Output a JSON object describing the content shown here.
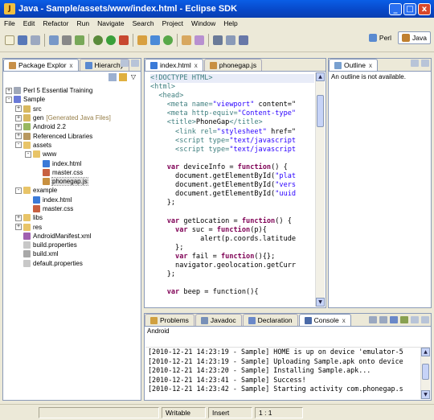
{
  "window": {
    "title": "Java - Sample/assets/www/index.html - Eclipse SDK",
    "min": "_",
    "max": "□",
    "close": "x"
  },
  "menu": [
    "File",
    "Edit",
    "Refactor",
    "Run",
    "Navigate",
    "Search",
    "Project",
    "Window",
    "Help"
  ],
  "perspectives": [
    {
      "label": "Perl",
      "color": "#5a8ad0"
    },
    {
      "label": "Java",
      "color": "#c08030"
    }
  ],
  "package_explorer": {
    "tabs": [
      {
        "label": "Package Explor",
        "close": "x"
      },
      {
        "label": "Hierarchy"
      }
    ],
    "tree": [
      {
        "label": "Perl 5 Essential Training",
        "depth": 0,
        "tw": "+",
        "icon": "#a0a8b8"
      },
      {
        "label": "Sample",
        "depth": 0,
        "tw": "-",
        "icon": "#6a7ad8"
      },
      {
        "label": "src",
        "depth": 1,
        "tw": "+",
        "icon": "#d8b860"
      },
      {
        "label": "gen",
        "extra": "[Generated Java Files]",
        "depth": 1,
        "tw": "+",
        "icon": "#d8b860"
      },
      {
        "label": "Android 2.2",
        "depth": 1,
        "tw": "+",
        "icon": "#98b860"
      },
      {
        "label": "Referenced Libraries",
        "depth": 1,
        "tw": "+",
        "icon": "#b89860"
      },
      {
        "label": "assets",
        "depth": 1,
        "tw": "-",
        "icon": "#e8c468"
      },
      {
        "label": "www",
        "depth": 2,
        "tw": "-",
        "icon": "#e8c468"
      },
      {
        "label": "index.html",
        "depth": 3,
        "tw": "",
        "icon": "#3a7ad8"
      },
      {
        "label": "master.css",
        "depth": 3,
        "tw": "",
        "icon": "#c86040"
      },
      {
        "label": "phonegap.js",
        "depth": 3,
        "tw": "",
        "icon": "#c89040",
        "selected": true
      },
      {
        "label": "example",
        "depth": 1,
        "tw": "-",
        "icon": "#e8c468"
      },
      {
        "label": "index.html",
        "depth": 2,
        "tw": "",
        "icon": "#3a7ad8"
      },
      {
        "label": "master.css",
        "depth": 2,
        "tw": "",
        "icon": "#c86040"
      },
      {
        "label": "libs",
        "depth": 1,
        "tw": "+",
        "icon": "#e8c468"
      },
      {
        "label": "res",
        "depth": 1,
        "tw": "+",
        "icon": "#e8c468"
      },
      {
        "label": "AndroidManifest.xml",
        "depth": 1,
        "tw": "",
        "icon": "#a060b0"
      },
      {
        "label": "build.properties",
        "depth": 1,
        "tw": "",
        "icon": "#c8c8c8"
      },
      {
        "label": "build.xml",
        "depth": 1,
        "tw": "",
        "icon": "#a8a8a8"
      },
      {
        "label": "default.properties",
        "depth": 1,
        "tw": "",
        "icon": "#c8c8c8"
      }
    ]
  },
  "editor": {
    "tabs": [
      {
        "label": "index.html",
        "close": "x"
      },
      {
        "label": "phonegap.js"
      }
    ],
    "lines": [
      [
        [
          "<!DOCTYPE HTML>",
          "tag"
        ]
      ],
      [
        [
          "<html>",
          "tag"
        ]
      ],
      [
        [
          "  <head>",
          "tag"
        ]
      ],
      [
        [
          "    <meta ",
          "tag"
        ],
        [
          "name=",
          "tag"
        ],
        [
          "\"viewport\"",
          "str"
        ],
        [
          " content=\"",
          ""
        ]
      ],
      [
        [
          "    <meta ",
          "tag"
        ],
        [
          "http-equiv=",
          "tag"
        ],
        [
          "\"Content-type\"",
          "str"
        ]
      ],
      [
        [
          "    <title>",
          "tag"
        ],
        [
          "PhoneGap",
          ""
        ],
        [
          "</title>",
          "tag"
        ]
      ],
      [
        [
          "      <link ",
          "tag"
        ],
        [
          "rel=",
          "tag"
        ],
        [
          "\"stylesheet\"",
          "str"
        ],
        [
          " href=\"",
          ""
        ]
      ],
      [
        [
          "      <script ",
          "tag"
        ],
        [
          "type=",
          "tag"
        ],
        [
          "\"text/javascript",
          "str"
        ]
      ],
      [
        [
          "      <script ",
          "tag"
        ],
        [
          "type=",
          "tag"
        ],
        [
          "\"text/javascript",
          "str"
        ]
      ],
      [
        [
          "",
          ""
        ]
      ],
      [
        [
          "    ",
          ""
        ],
        [
          "var",
          "kw"
        ],
        [
          " deviceInfo = ",
          ""
        ],
        [
          "function",
          "kw"
        ],
        [
          "() {",
          ""
        ]
      ],
      [
        [
          "      document.getElementById(",
          ""
        ],
        [
          "\"plat",
          "str"
        ]
      ],
      [
        [
          "      document.getElementById(",
          ""
        ],
        [
          "\"vers",
          "str"
        ]
      ],
      [
        [
          "      document.getElementById(",
          ""
        ],
        [
          "\"uuid",
          "str"
        ]
      ],
      [
        [
          "    };",
          ""
        ]
      ],
      [
        [
          "",
          ""
        ]
      ],
      [
        [
          "    ",
          ""
        ],
        [
          "var",
          "kw"
        ],
        [
          " getLocation = ",
          ""
        ],
        [
          "function",
          "kw"
        ],
        [
          "() {",
          ""
        ]
      ],
      [
        [
          "      ",
          ""
        ],
        [
          "var",
          "kw"
        ],
        [
          " suc = ",
          ""
        ],
        [
          "function",
          "kw"
        ],
        [
          "(p){",
          ""
        ]
      ],
      [
        [
          "            alert(p.coords.latitude",
          ""
        ]
      ],
      [
        [
          "      };",
          ""
        ]
      ],
      [
        [
          "      ",
          ""
        ],
        [
          "var",
          "kw"
        ],
        [
          " fail = ",
          ""
        ],
        [
          "function",
          "kw"
        ],
        [
          "(){};",
          ""
        ]
      ],
      [
        [
          "      navigator.geolocation.getCurr",
          ""
        ]
      ],
      [
        [
          "    };",
          ""
        ]
      ],
      [
        [
          "",
          ""
        ]
      ],
      [
        [
          "    ",
          ""
        ],
        [
          "var",
          "kw"
        ],
        [
          " beep = function(){",
          ""
        ]
      ]
    ]
  },
  "outline": {
    "tab": "Outline",
    "close": "x",
    "message": "An outline is not available."
  },
  "console": {
    "tabs": [
      "Problems",
      "Javadoc",
      "Declaration",
      "Console"
    ],
    "active": "Console",
    "close": "x",
    "header": "Android",
    "lines": [
      "[2010-12-21 14:23:19 - Sample] HOME is up on device 'emulator-5",
      "[2010-12-21 14:23:19 - Sample] Uploading Sample.apk onto device",
      "[2010-12-21 14:23:20 - Sample] Installing Sample.apk...",
      "[2010-12-21 14:23:41 - Sample] Success!",
      "[2010-12-21 14:23:42 - Sample] Starting activity com.phonegap.s"
    ]
  },
  "status": {
    "writable": "Writable",
    "insert": "Insert",
    "position": "1 : 1"
  }
}
